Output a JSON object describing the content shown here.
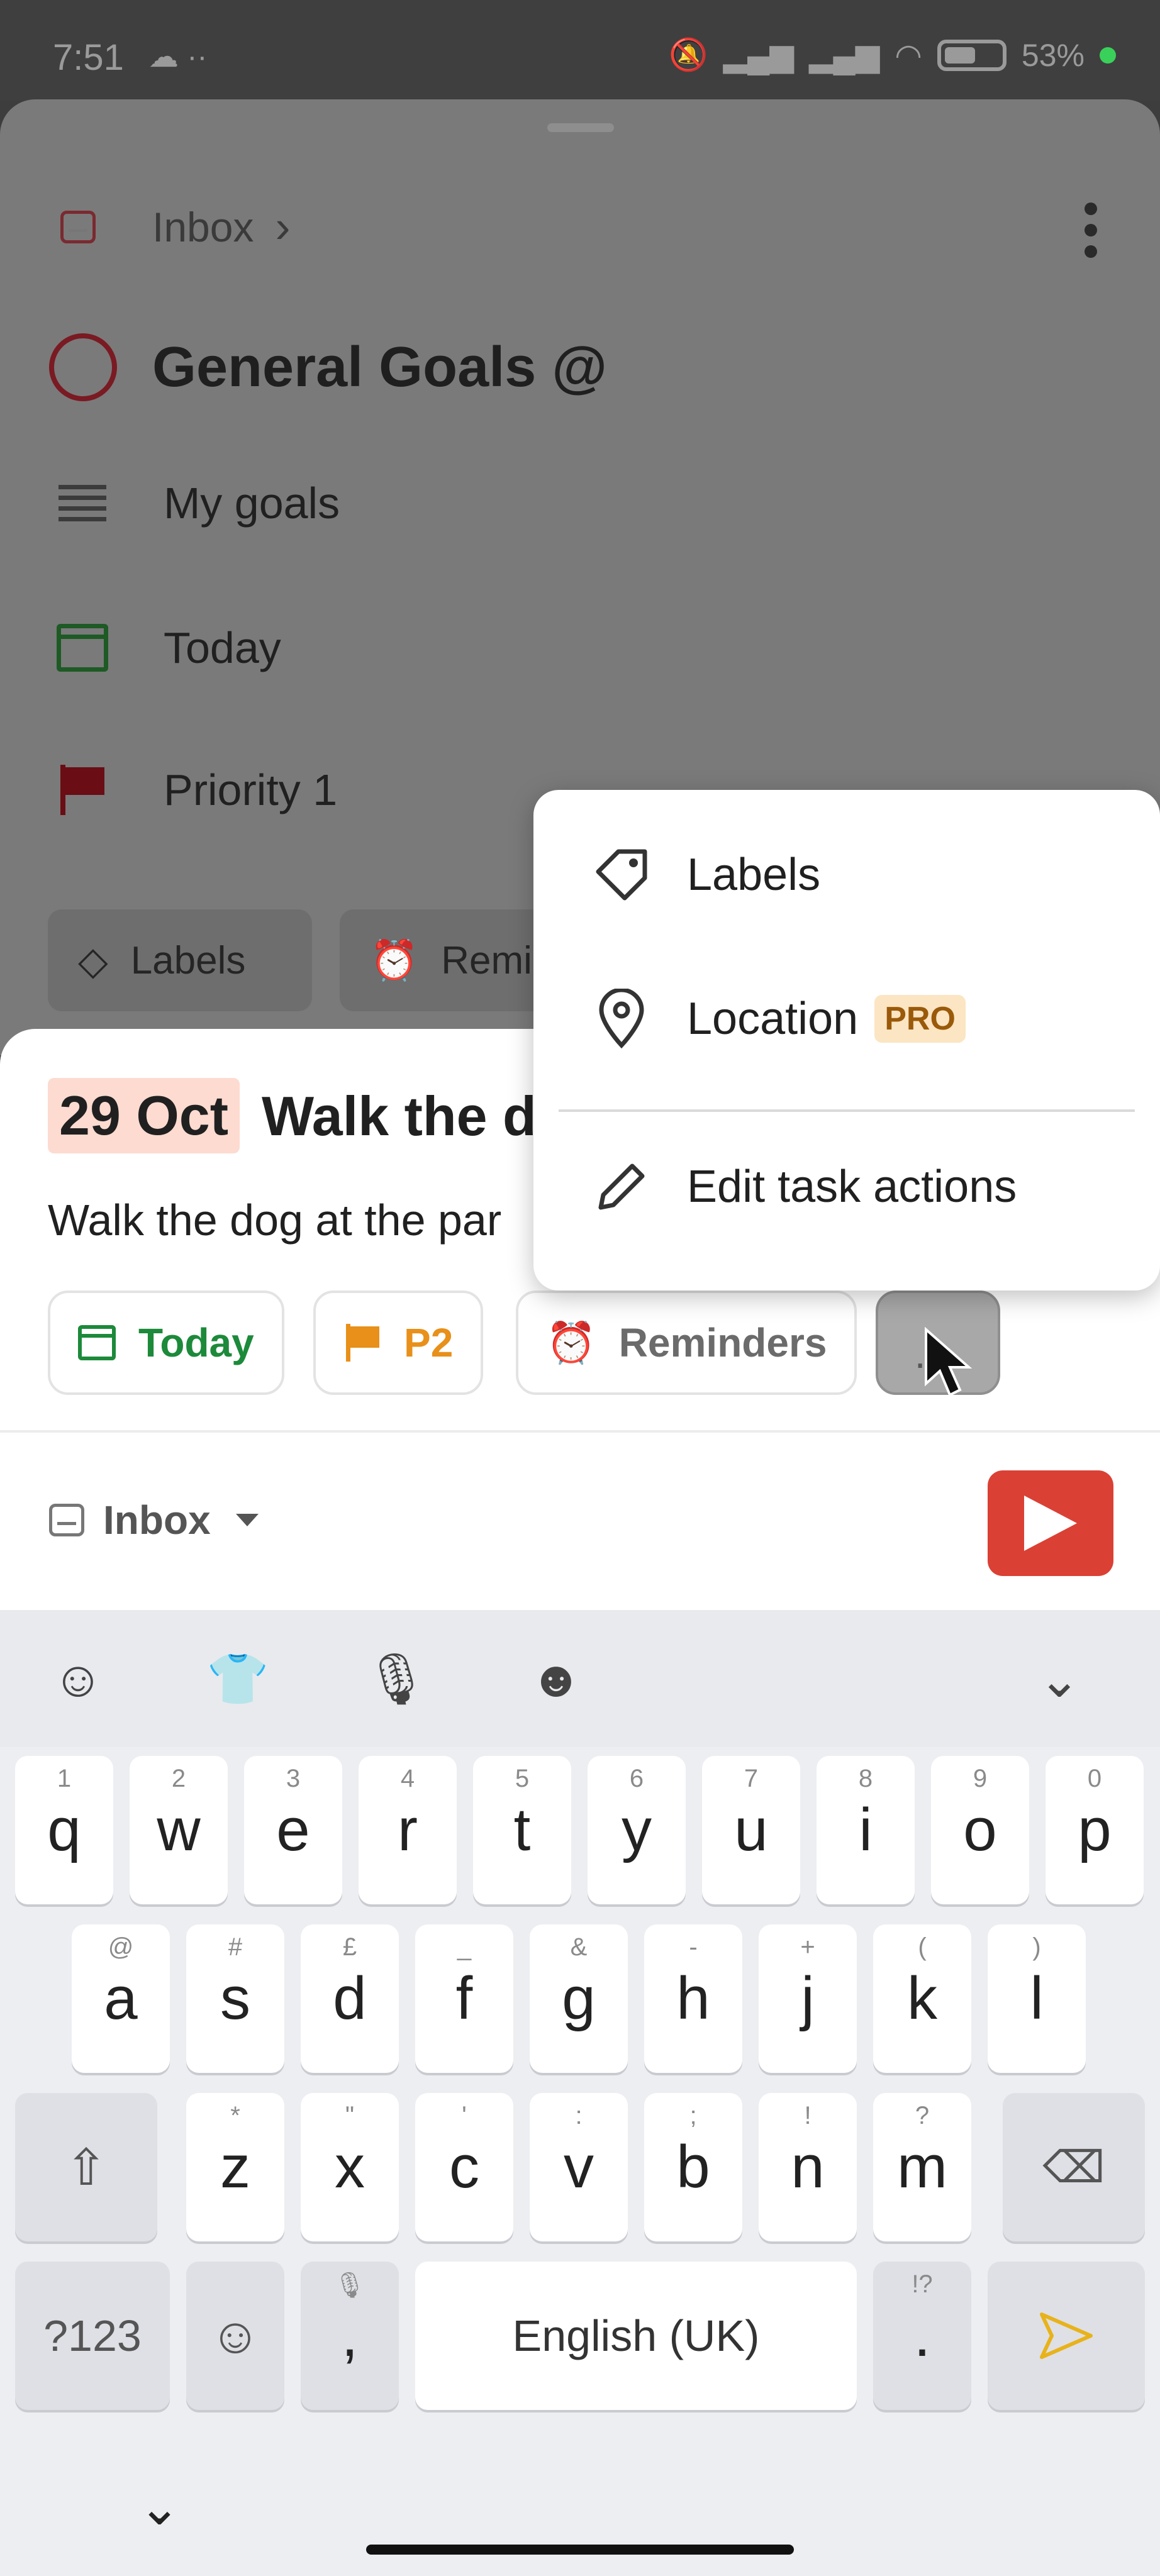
{
  "status_bar": {
    "time": "7:51",
    "left_icons": "☁ ··",
    "battery_percent": "53%"
  },
  "task_detail": {
    "breadcrumb": "Inbox",
    "task_title": "General Goals @",
    "rows": [
      {
        "icon": "description-lines-icon",
        "label": "My goals"
      },
      {
        "icon": "calendar-icon",
        "label": "Today"
      },
      {
        "icon": "priority-flag-icon",
        "label": "Priority 1"
      }
    ],
    "chips": {
      "labels": "Labels",
      "reminders": "Remi"
    }
  },
  "quick_add": {
    "date_tag": "29 Oct",
    "task_name": "Walk the d",
    "description": "Walk the dog at the par",
    "chips": {
      "date": "Today",
      "priority": "P2",
      "reminders": "Reminders",
      "more": "··"
    },
    "project": "Inbox"
  },
  "menu": {
    "items": [
      {
        "label": "Labels",
        "icon": "tag-icon"
      },
      {
        "label": "Location",
        "icon": "location-pin-icon",
        "badge": "PRO"
      },
      {
        "label": "Edit task actions",
        "icon": "pencil-icon"
      }
    ]
  },
  "keyboard": {
    "row1": [
      {
        "key": "q",
        "hint": "1"
      },
      {
        "key": "w",
        "hint": "2"
      },
      {
        "key": "e",
        "hint": "3"
      },
      {
        "key": "r",
        "hint": "4"
      },
      {
        "key": "t",
        "hint": "5"
      },
      {
        "key": "y",
        "hint": "6"
      },
      {
        "key": "u",
        "hint": "7"
      },
      {
        "key": "i",
        "hint": "8"
      },
      {
        "key": "o",
        "hint": "9"
      },
      {
        "key": "p",
        "hint": "0"
      }
    ],
    "row2": [
      {
        "key": "a",
        "hint": "@"
      },
      {
        "key": "s",
        "hint": "#"
      },
      {
        "key": "d",
        "hint": "£"
      },
      {
        "key": "f",
        "hint": "_"
      },
      {
        "key": "g",
        "hint": "&"
      },
      {
        "key": "h",
        "hint": "-"
      },
      {
        "key": "j",
        "hint": "+"
      },
      {
        "key": "k",
        "hint": "("
      },
      {
        "key": "l",
        "hint": ")"
      }
    ],
    "row3": [
      {
        "key": "z",
        "hint": "*"
      },
      {
        "key": "x",
        "hint": "\""
      },
      {
        "key": "c",
        "hint": "'"
      },
      {
        "key": "v",
        "hint": ":"
      },
      {
        "key": "b",
        "hint": ";"
      },
      {
        "key": "n",
        "hint": "!"
      },
      {
        "key": "m",
        "hint": "?"
      }
    ],
    "symbols": "?123",
    "comma": ",",
    "space": "English (UK)",
    "period": ".",
    "period_hint": "!?"
  }
}
